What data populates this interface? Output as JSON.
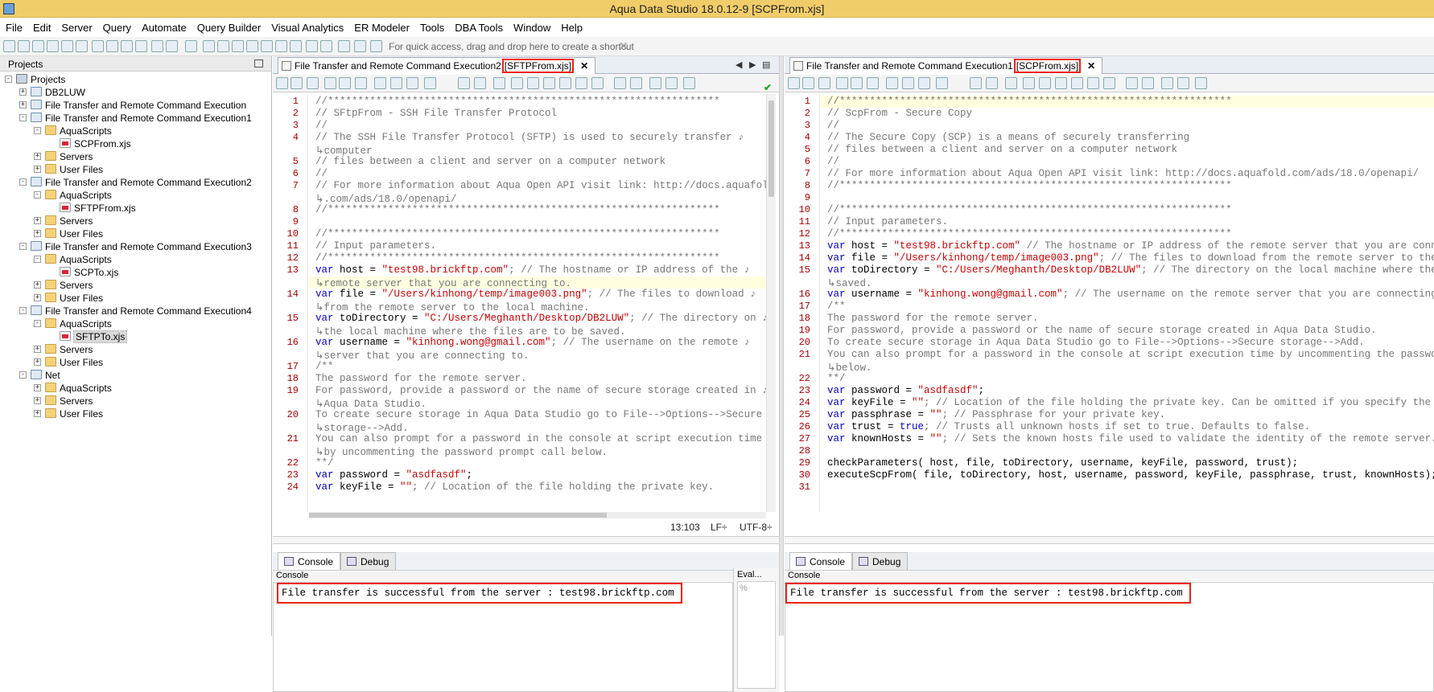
{
  "window": {
    "title": "Aqua Data Studio 18.0.12-9 [SCPFrom.xjs]"
  },
  "menu": [
    "File",
    "Edit",
    "Server",
    "Query",
    "Automate",
    "Query Builder",
    "Visual Analytics",
    "ER Modeler",
    "Tools",
    "DBA Tools",
    "Window",
    "Help"
  ],
  "toolbar": {
    "shortcut_hint": "For quick access, drag and drop here to create a shortcut",
    "close": "✕"
  },
  "projects": {
    "title": "Projects",
    "items": [
      {
        "label": "Projects",
        "depth": 0,
        "icon": "root",
        "exp": "-"
      },
      {
        "label": "DB2LUW",
        "depth": 1,
        "icon": "proj",
        "exp": "+"
      },
      {
        "label": "File Transfer and Remote Command Execution",
        "depth": 1,
        "icon": "proj",
        "exp": "+"
      },
      {
        "label": "File Transfer and Remote Command Execution1",
        "depth": 1,
        "icon": "proj",
        "exp": "-"
      },
      {
        "label": "AquaScripts",
        "depth": 2,
        "icon": "folder",
        "exp": "-"
      },
      {
        "label": "SCPFrom.xjs",
        "depth": 3,
        "icon": "file",
        "exp": ""
      },
      {
        "label": "Servers",
        "depth": 2,
        "icon": "folder",
        "exp": "+"
      },
      {
        "label": "User Files",
        "depth": 2,
        "icon": "folder",
        "exp": "+"
      },
      {
        "label": "File Transfer and Remote Command Execution2",
        "depth": 1,
        "icon": "proj",
        "exp": "-"
      },
      {
        "label": "AquaScripts",
        "depth": 2,
        "icon": "folder",
        "exp": "-"
      },
      {
        "label": "SFTPFrom.xjs",
        "depth": 3,
        "icon": "file",
        "exp": ""
      },
      {
        "label": "Servers",
        "depth": 2,
        "icon": "folder",
        "exp": "+"
      },
      {
        "label": "User Files",
        "depth": 2,
        "icon": "folder",
        "exp": "+"
      },
      {
        "label": "File Transfer and Remote Command Execution3",
        "depth": 1,
        "icon": "proj",
        "exp": "-"
      },
      {
        "label": "AquaScripts",
        "depth": 2,
        "icon": "folder",
        "exp": "-"
      },
      {
        "label": "SCPTo.xjs",
        "depth": 3,
        "icon": "file",
        "exp": ""
      },
      {
        "label": "Servers",
        "depth": 2,
        "icon": "folder",
        "exp": "+"
      },
      {
        "label": "User Files",
        "depth": 2,
        "icon": "folder",
        "exp": "+"
      },
      {
        "label": "File Transfer and Remote Command Execution4",
        "depth": 1,
        "icon": "proj",
        "exp": "-"
      },
      {
        "label": "AquaScripts",
        "depth": 2,
        "icon": "folder",
        "exp": "-"
      },
      {
        "label": "SFTPTo.xjs",
        "depth": 3,
        "icon": "file",
        "exp": "",
        "selected": true
      },
      {
        "label": "Servers",
        "depth": 2,
        "icon": "folder",
        "exp": "+"
      },
      {
        "label": "User Files",
        "depth": 2,
        "icon": "folder",
        "exp": "+"
      },
      {
        "label": "Net",
        "depth": 1,
        "icon": "proj",
        "exp": "-"
      },
      {
        "label": "AquaScripts",
        "depth": 2,
        "icon": "folder",
        "exp": "+"
      },
      {
        "label": "Servers",
        "depth": 2,
        "icon": "folder",
        "exp": "+"
      },
      {
        "label": "User Files",
        "depth": 2,
        "icon": "folder",
        "exp": "+"
      }
    ]
  },
  "left_editor": {
    "tab_prefix": "File Transfer and Remote Command Execution2",
    "tab_file": "[SFTPFrom.xjs]",
    "tab_close": "✕",
    "status_pos": "13:103",
    "status_lf": "LF÷",
    "status_enc": "UTF-8÷",
    "console_tab": "Console",
    "debug_tab": "Debug",
    "console_label": "Console",
    "eval_label": "Eval...",
    "eval_sub": "%",
    "console_output": "File transfer is successful from the server : test98.brickftp.com",
    "rows": [
      {
        "n": "1",
        "segs": [
          {
            "t": "//*****************************************************************",
            "c": "cm"
          }
        ]
      },
      {
        "n": "2",
        "segs": [
          {
            "t": "// SFtpFrom - SSH File Transfer Protocol",
            "c": "cm"
          }
        ]
      },
      {
        "n": "3",
        "segs": [
          {
            "t": "//",
            "c": "cm"
          }
        ]
      },
      {
        "n": "4",
        "segs": [
          {
            "t": "// The SSH File Transfer Protocol (SFTP) is used to securely transfer ♪",
            "c": "cm"
          }
        ]
      },
      {
        "n": "",
        "segs": [
          {
            "t": "↳computer",
            "c": "cm"
          }
        ]
      },
      {
        "n": "5",
        "segs": [
          {
            "t": "// files between a client and server on a computer network",
            "c": "cm"
          }
        ]
      },
      {
        "n": "6",
        "segs": [
          {
            "t": "//",
            "c": "cm"
          }
        ]
      },
      {
        "n": "7",
        "segs": [
          {
            "t": "// For more information about Aqua Open API visit link: http://docs.aquafold",
            "c": "cm"
          }
        ]
      },
      {
        "n": "",
        "segs": [
          {
            "t": "↳.com/ads/18.0/openapi/",
            "c": "cm"
          }
        ]
      },
      {
        "n": "8",
        "segs": [
          {
            "t": "//*****************************************************************",
            "c": "cm"
          }
        ]
      },
      {
        "n": "9",
        "segs": []
      },
      {
        "n": "10",
        "segs": [
          {
            "t": "//*****************************************************************",
            "c": "cm"
          }
        ]
      },
      {
        "n": "11",
        "segs": [
          {
            "t": "// Input parameters.",
            "c": "cm"
          }
        ]
      },
      {
        "n": "12",
        "segs": [
          {
            "t": "//*****************************************************************",
            "c": "cm"
          }
        ]
      },
      {
        "n": "13",
        "segs": [
          {
            "t": "var",
            "c": "kw"
          },
          {
            "t": " host = ",
            "c": ""
          },
          {
            "t": "\"test98.brickftp.com\"",
            "c": "st"
          },
          {
            "t": "; // The hostname or IP address of the ♪",
            "c": "cm"
          }
        ]
      },
      {
        "n": "",
        "segs": [
          {
            "t": "↳remote server that you are connecting to.",
            "c": "cm"
          }
        ],
        "cur": true
      },
      {
        "n": "14",
        "segs": [
          {
            "t": "var",
            "c": "kw"
          },
          {
            "t": " file = ",
            "c": ""
          },
          {
            "t": "\"/Users/kinhong/temp/image003.png\"",
            "c": "st"
          },
          {
            "t": "; // The files to download ♪",
            "c": "cm"
          }
        ]
      },
      {
        "n": "",
        "segs": [
          {
            "t": "↳from the remote server to the local machine.",
            "c": "cm"
          }
        ]
      },
      {
        "n": "15",
        "segs": [
          {
            "t": "var",
            "c": "kw"
          },
          {
            "t": " toDirectory = ",
            "c": ""
          },
          {
            "t": "\"C:/Users/Meghanth/Desktop/DB2LUW\"",
            "c": "st"
          },
          {
            "t": "; // The directory on ♪",
            "c": "cm"
          }
        ]
      },
      {
        "n": "",
        "segs": [
          {
            "t": "↳the local machine where the files are to be saved.",
            "c": "cm"
          }
        ]
      },
      {
        "n": "16",
        "segs": [
          {
            "t": "var",
            "c": "kw"
          },
          {
            "t": " username = ",
            "c": ""
          },
          {
            "t": "\"kinhong.wong@gmail.com\"",
            "c": "st"
          },
          {
            "t": "; // The username on the remote ♪",
            "c": "cm"
          }
        ]
      },
      {
        "n": "",
        "segs": [
          {
            "t": "↳server that you are connecting to.",
            "c": "cm"
          }
        ]
      },
      {
        "n": "17",
        "segs": [
          {
            "t": "/**",
            "c": "cm"
          }
        ]
      },
      {
        "n": "18",
        "segs": [
          {
            "t": "The password for the remote server.",
            "c": "cm"
          }
        ]
      },
      {
        "n": "19",
        "segs": [
          {
            "t": "For password, provide a password or the name of secure storage created in ♪",
            "c": "cm"
          }
        ]
      },
      {
        "n": "",
        "segs": [
          {
            "t": "↳Aqua Data Studio.",
            "c": "cm"
          }
        ]
      },
      {
        "n": "20",
        "segs": [
          {
            "t": "To create secure storage in Aqua Data Studio go to File-->Options-->Secure ♪",
            "c": "cm"
          }
        ]
      },
      {
        "n": "",
        "segs": [
          {
            "t": "↳storage-->Add.",
            "c": "cm"
          }
        ]
      },
      {
        "n": "21",
        "segs": [
          {
            "t": "You can also prompt for a password in the console at script execution time ♪",
            "c": "cm"
          }
        ]
      },
      {
        "n": "",
        "segs": [
          {
            "t": "↳by uncommenting the password prompt call below.",
            "c": "cm"
          }
        ]
      },
      {
        "n": "22",
        "segs": [
          {
            "t": "**/",
            "c": "cm"
          }
        ]
      },
      {
        "n": "23",
        "segs": [
          {
            "t": "var",
            "c": "kw"
          },
          {
            "t": " password = ",
            "c": ""
          },
          {
            "t": "\"asdfasdf\"",
            "c": "st"
          },
          {
            "t": ";",
            "c": ""
          }
        ]
      },
      {
        "n": "24",
        "segs": [
          {
            "t": "var",
            "c": "kw"
          },
          {
            "t": " keyFile = ",
            "c": ""
          },
          {
            "t": "\"\"",
            "c": "st"
          },
          {
            "t": "; // Location of the file holding the private key.",
            "c": "cm"
          }
        ]
      }
    ]
  },
  "right_editor": {
    "tab_prefix": "File Transfer and Remote Command Execution1",
    "tab_file": "[SCPFrom.xjs]",
    "tab_close": "✕",
    "console_tab": "Console",
    "debug_tab": "Debug",
    "console_label": "Console",
    "console_output": "File transfer is successful from the server : test98.brickftp.com",
    "rows": [
      {
        "n": "1",
        "segs": [
          {
            "t": "//*****************************************************************",
            "c": "cm"
          }
        ],
        "cur": true
      },
      {
        "n": "2",
        "segs": [
          {
            "t": "// ScpFrom - Secure Copy",
            "c": "cm"
          }
        ]
      },
      {
        "n": "3",
        "segs": [
          {
            "t": "//",
            "c": "cm"
          }
        ]
      },
      {
        "n": "4",
        "segs": [
          {
            "t": "// The Secure Copy (SCP) is a means of securely transferring",
            "c": "cm"
          }
        ]
      },
      {
        "n": "5",
        "segs": [
          {
            "t": "// files between a client and server on a computer network",
            "c": "cm"
          }
        ]
      },
      {
        "n": "6",
        "segs": [
          {
            "t": "//",
            "c": "cm"
          }
        ]
      },
      {
        "n": "7",
        "segs": [
          {
            "t": "// For more information about Aqua Open API visit link: http://docs.aquafold.com/ads/18.0/openapi/",
            "c": "cm"
          }
        ]
      },
      {
        "n": "8",
        "segs": [
          {
            "t": "//*****************************************************************",
            "c": "cm"
          }
        ]
      },
      {
        "n": "9",
        "segs": []
      },
      {
        "n": "10",
        "segs": [
          {
            "t": "//*****************************************************************",
            "c": "cm"
          }
        ]
      },
      {
        "n": "11",
        "segs": [
          {
            "t": "// Input parameters.",
            "c": "cm"
          }
        ]
      },
      {
        "n": "12",
        "segs": [
          {
            "t": "//*****************************************************************",
            "c": "cm"
          }
        ]
      },
      {
        "n": "13",
        "segs": [
          {
            "t": "var",
            "c": "kw"
          },
          {
            "t": " host = ",
            "c": ""
          },
          {
            "t": "\"test98.brickftp.com\"",
            "c": "st"
          },
          {
            "t": " // The hostname or IP address of the remote server that you are connecting",
            "c": "cm"
          }
        ]
      },
      {
        "n": "14",
        "segs": [
          {
            "t": "var",
            "c": "kw"
          },
          {
            "t": " file = ",
            "c": ""
          },
          {
            "t": "\"/Users/kinhong/temp/image003.png\"",
            "c": "st"
          },
          {
            "t": "; // The files to download from the remote server to the local",
            "c": "cm"
          }
        ]
      },
      {
        "n": "15",
        "segs": [
          {
            "t": "var",
            "c": "kw"
          },
          {
            "t": " toDirectory = ",
            "c": ""
          },
          {
            "t": "\"C:/Users/Meghanth/Desktop/DB2LUW\"",
            "c": "st"
          },
          {
            "t": "; // The directory on the local machine where the files",
            "c": "cm"
          }
        ]
      },
      {
        "n": "",
        "segs": [
          {
            "t": "↳saved.",
            "c": "cm"
          }
        ]
      },
      {
        "n": "16",
        "segs": [
          {
            "t": "var",
            "c": "kw"
          },
          {
            "t": " username = ",
            "c": ""
          },
          {
            "t": "\"kinhong.wong@gmail.com\"",
            "c": "st"
          },
          {
            "t": "; // The username on the remote server that you are connecting to.",
            "c": "cm"
          }
        ]
      },
      {
        "n": "17",
        "segs": [
          {
            "t": "/**",
            "c": "cm"
          }
        ]
      },
      {
        "n": "18",
        "segs": [
          {
            "t": "The password for the remote server.",
            "c": "cm"
          }
        ]
      },
      {
        "n": "19",
        "segs": [
          {
            "t": "For password, provide a password or the name of secure storage created in Aqua Data Studio.",
            "c": "cm"
          }
        ]
      },
      {
        "n": "20",
        "segs": [
          {
            "t": "To create secure storage in Aqua Data Studio go to File-->Options-->Secure storage-->Add.",
            "c": "cm"
          }
        ]
      },
      {
        "n": "21",
        "segs": [
          {
            "t": "You can also prompt for a password in the console at script execution time by uncommenting the password prom",
            "c": "cm"
          }
        ]
      },
      {
        "n": "",
        "segs": [
          {
            "t": "↳below.",
            "c": "cm"
          }
        ]
      },
      {
        "n": "22",
        "segs": [
          {
            "t": "**/",
            "c": "cm"
          }
        ]
      },
      {
        "n": "23",
        "segs": [
          {
            "t": "var",
            "c": "kw"
          },
          {
            "t": " password = ",
            "c": ""
          },
          {
            "t": "\"asdfasdf\"",
            "c": "st"
          },
          {
            "t": ";",
            "c": ""
          }
        ]
      },
      {
        "n": "24",
        "segs": [
          {
            "t": "var",
            "c": "kw"
          },
          {
            "t": " keyFile = ",
            "c": ""
          },
          {
            "t": "\"\"",
            "c": "st"
          },
          {
            "t": "; // Location of the file holding the private key. Can be omitted if you specify the passwor",
            "c": "cm"
          }
        ]
      },
      {
        "n": "25",
        "segs": [
          {
            "t": "var",
            "c": "kw"
          },
          {
            "t": " passphrase = ",
            "c": ""
          },
          {
            "t": "\"\"",
            "c": "st"
          },
          {
            "t": "; // Passphrase for your private key.",
            "c": "cm"
          }
        ]
      },
      {
        "n": "26",
        "segs": [
          {
            "t": "var",
            "c": "kw"
          },
          {
            "t": " trust = ",
            "c": ""
          },
          {
            "t": "true",
            "c": "kw"
          },
          {
            "t": "; // Trusts all unknown hosts if set to true. Defaults to false.",
            "c": "cm"
          }
        ]
      },
      {
        "n": "27",
        "segs": [
          {
            "t": "var",
            "c": "kw"
          },
          {
            "t": " knownHosts = ",
            "c": ""
          },
          {
            "t": "\"\"",
            "c": "st"
          },
          {
            "t": "; // Sets the known hosts file used to validate the identity of the remote server.",
            "c": "cm"
          }
        ]
      },
      {
        "n": "28",
        "segs": []
      },
      {
        "n": "29",
        "segs": [
          {
            "t": "checkParameters( host, file, toDirectory, username, keyFile, password, trust);",
            "c": ""
          }
        ]
      },
      {
        "n": "30",
        "segs": [
          {
            "t": "executeScpFrom( file, toDirectory, host, username, password, keyFile, passphrase, trust, knownHosts);",
            "c": ""
          }
        ]
      },
      {
        "n": "31",
        "segs": []
      }
    ]
  },
  "colors": {
    "title_bar": "#f1cd6a",
    "highlight_box": "#e21",
    "keyword": "#00c",
    "string": "#c00",
    "comment": "#777",
    "line_number": "#a00"
  }
}
